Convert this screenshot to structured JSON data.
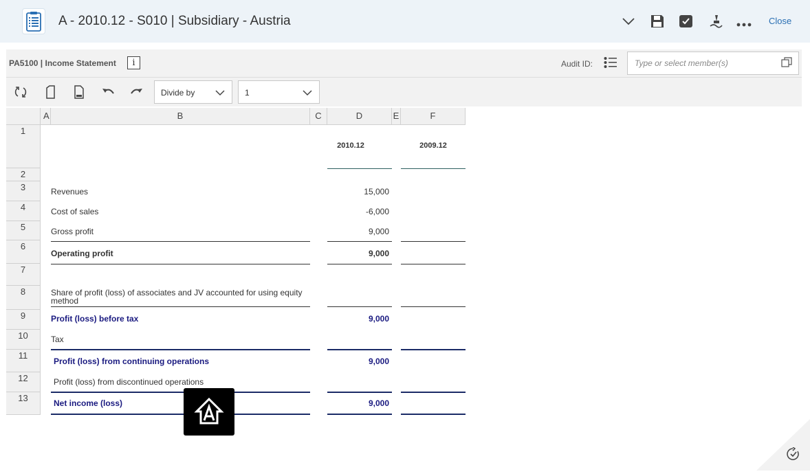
{
  "header": {
    "title": "A - 2010.12 - S010 | Subsidiary - Austria",
    "close_label": "Close"
  },
  "toolbar": {
    "form_name": "PA5100 | Income Statement",
    "info_label": "i",
    "audit_label": "Audit ID:",
    "member_placeholder": "Type or select member(s)",
    "divide_by_value": "Divide by",
    "divisor_value": "1"
  },
  "grid": {
    "columns": [
      "A",
      "B",
      "C",
      "D",
      "E",
      "F"
    ],
    "rows": [
      "1",
      "2",
      "3",
      "4",
      "5",
      "6",
      "7",
      "8",
      "9",
      "10",
      "11",
      "12",
      "13"
    ],
    "period_headers": [
      "2010.12",
      "2009.12"
    ],
    "lines": [
      {
        "label": "Revenues",
        "d": "15,000"
      },
      {
        "label": "Cost of sales",
        "d": "-6,000"
      },
      {
        "label": "Gross profit",
        "d": "9,000"
      },
      {
        "label": "Operating profit",
        "d": "9,000"
      },
      {
        "label": "Share of profit (loss) of associates and JV accounted for using equity",
        "label2": "method",
        "d": ""
      },
      {
        "label": "Profit (loss) before tax",
        "d": "9,000"
      },
      {
        "label": "Tax",
        "d": ""
      },
      {
        "label": "Profit (loss) from continuing operations",
        "d": "9,000"
      },
      {
        "label": "Profit (loss) from discontinued operations",
        "d": ""
      },
      {
        "label": "Net income (loss)",
        "d": "9,000"
      }
    ]
  },
  "colors": {
    "header_bg": "#edf3f8",
    "link": "#2a6fb3",
    "subtotal_blue": "#1a1a80"
  }
}
